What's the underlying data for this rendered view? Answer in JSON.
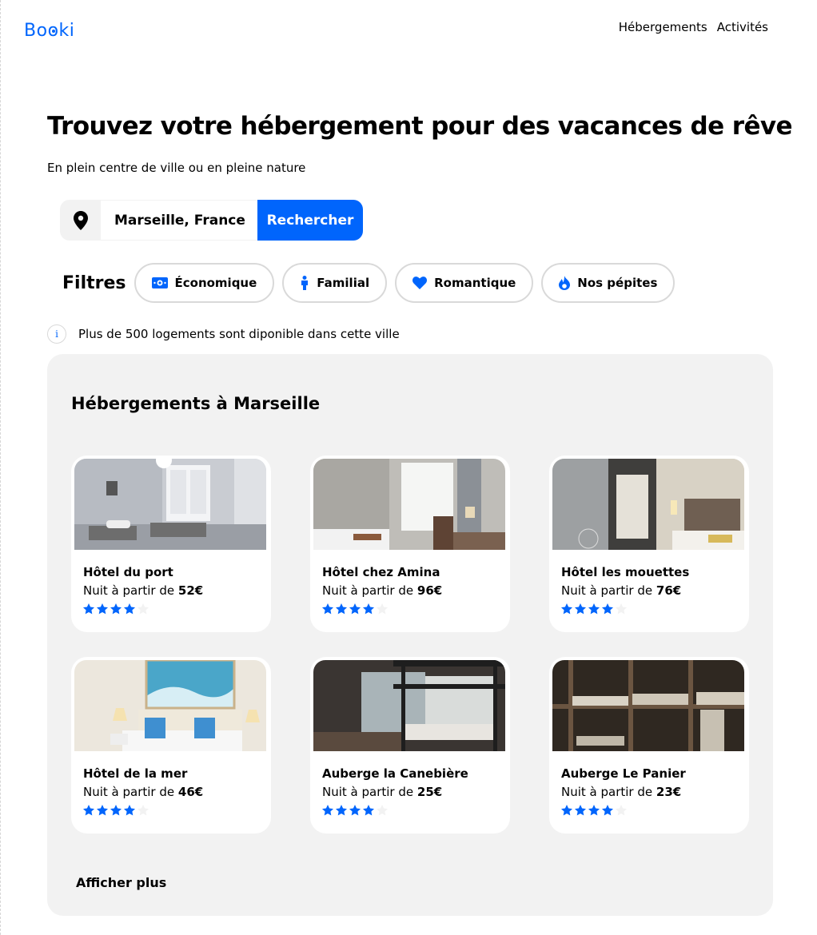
{
  "header": {
    "logo": "Booki",
    "nav": [
      "Hébergements",
      "Activités"
    ]
  },
  "hero": {
    "title": "Trouvez votre hébergement pour des vacances de rêve",
    "subtitle": "En plein centre de ville ou en pleine nature"
  },
  "search": {
    "value": "Marseille, France",
    "button": "Rechercher",
    "icon": "map-pin-icon"
  },
  "filters": {
    "label": "Filtres",
    "chips": [
      {
        "label": "Économique",
        "icon": "money-icon"
      },
      {
        "label": "Familial",
        "icon": "person-icon"
      },
      {
        "label": "Romantique",
        "icon": "heart-icon"
      },
      {
        "label": "Nos pépites",
        "icon": "flame-icon"
      }
    ]
  },
  "info": {
    "text": "Plus de 500 logements sont diponible dans cette ville",
    "icon": "info-icon"
  },
  "listing": {
    "title": "Hébergements à Marseille",
    "price_prefix": "Nuit à partir de ",
    "cards": [
      {
        "name": "Hôtel du port",
        "price": "52€",
        "rating": 4
      },
      {
        "name": "Hôtel chez Amina",
        "price": "96€",
        "rating": 4
      },
      {
        "name": "Hôtel les mouettes",
        "price": "76€",
        "rating": 4
      },
      {
        "name": "Hôtel de la mer",
        "price": "46€",
        "rating": 4
      },
      {
        "name": "Auberge la Canebière",
        "price": "25€",
        "rating": 4
      },
      {
        "name": "Auberge Le Panier",
        "price": "23€",
        "rating": 4
      }
    ],
    "more": "Afficher plus"
  },
  "colors": {
    "accent": "#0065FC",
    "panel": "#F2F2F2",
    "border": "#D9D9D9"
  }
}
